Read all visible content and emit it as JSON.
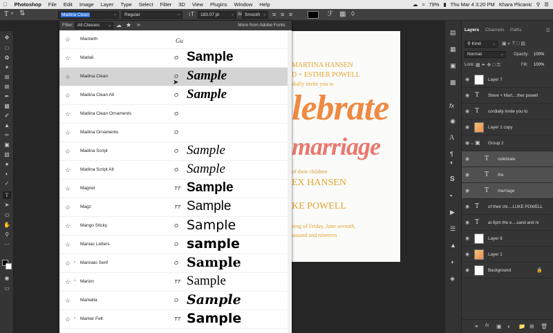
{
  "menubar": {
    "app": "Photoshop",
    "items": [
      "File",
      "Edit",
      "Image",
      "Layer",
      "Type",
      "Select",
      "Filter",
      "3D",
      "View",
      "Plugins",
      "Window",
      "Help"
    ],
    "battery": "79%",
    "datetime": "Thu Mar 4  3:20 PM",
    "user": "Khara Plicanic"
  },
  "options": {
    "font_family": "Madina Clean",
    "font_style": "Regular",
    "font_size": "183.07 pt",
    "aa_label": "aa",
    "antialias": "Smooth"
  },
  "font_panel": {
    "filter_label": "Filter:",
    "filter_value": "All Classes",
    "adobe_fonts": "More from Adobe Fonts:",
    "fonts": [
      {
        "name": "Macbeth",
        "type": "",
        "sample": "",
        "highlight": false,
        "expandable": false
      },
      {
        "name": "Madali",
        "type": "O",
        "sample": "Sample",
        "highlight": false,
        "expandable": false
      },
      {
        "name": "Madina Clean",
        "type": "O",
        "sample": "Sample",
        "highlight": true,
        "expandable": false
      },
      {
        "name": "Madina Clean Alt",
        "type": "O",
        "sample": "Sample",
        "highlight": false,
        "expandable": false
      },
      {
        "name": "Madina Clean Ornaments",
        "type": "O",
        "sample": "",
        "highlight": false,
        "expandable": false
      },
      {
        "name": "Madina Ornaments",
        "type": "O",
        "sample": "",
        "highlight": false,
        "expandable": false
      },
      {
        "name": "Madina Script",
        "type": "O",
        "sample": "Sample",
        "highlight": false,
        "expandable": false
      },
      {
        "name": "Madina Script Alt",
        "type": "O",
        "sample": "Sample",
        "highlight": false,
        "expandable": false
      },
      {
        "name": "Magnel",
        "type": "TT",
        "sample": "Sample",
        "highlight": false,
        "expandable": false
      },
      {
        "name": "Magz",
        "type": "TT",
        "sample": "Sample",
        "highlight": false,
        "expandable": false
      },
      {
        "name": "Mango Sticky",
        "type": "O",
        "sample": "Sample",
        "highlight": false,
        "expandable": false
      },
      {
        "name": "Maniac Letters",
        "type": "O",
        "sample": "sample",
        "highlight": false,
        "expandable": false
      },
      {
        "name": "Marinaio Serif",
        "type": "O",
        "sample": "Sample",
        "highlight": false,
        "expandable": true
      },
      {
        "name": "Marion",
        "type": "TT",
        "sample": "Sample",
        "highlight": false,
        "expandable": true
      },
      {
        "name": "Markella",
        "type": "O",
        "sample": "Sample",
        "highlight": false,
        "expandable": false
      },
      {
        "name": "Marker Felt",
        "type": "TT",
        "sample": "Sample",
        "highlight": false,
        "expandable": true
      }
    ]
  },
  "canvas": {
    "line1": "MARTINA HANSEN",
    "line2": "D + ESTHER POWELL",
    "line3": "dially invite you to",
    "line4": "lebrate",
    "line5": "marriage",
    "line6": "of their children",
    "line7": "EX HANSEN",
    "line8": "KE POWELL",
    "line9": "ning of Friday, June seventh,",
    "line10": "ousand and nineteen"
  },
  "layers_panel": {
    "tabs": [
      "Layers",
      "Channels",
      "Paths"
    ],
    "kind": "Kind",
    "blend_mode": "Normal",
    "opacity_label": "Opacity:",
    "opacity": "100%",
    "lock_label": "Lock:",
    "fill_label": "Fill:",
    "fill": "100%",
    "layers": [
      {
        "name": "Layer 7",
        "kind": "thumb",
        "indent": 0,
        "selected": false
      },
      {
        "name": "Steve + Mart....ther powell",
        "kind": "text",
        "indent": 0,
        "selected": false
      },
      {
        "name": "cordially invite you to",
        "kind": "text",
        "indent": 0,
        "selected": false
      },
      {
        "name": "Layer 1 copy",
        "kind": "thumb-color",
        "indent": 0,
        "selected": false
      },
      {
        "name": "Group 2",
        "kind": "group",
        "indent": 0,
        "selected": false
      },
      {
        "name": "celebrate",
        "kind": "text",
        "indent": 1,
        "selected": true
      },
      {
        "name": "the",
        "kind": "text",
        "indent": 1,
        "selected": true
      },
      {
        "name": "marriage",
        "kind": "text",
        "indent": 1,
        "selected": true
      },
      {
        "name": "of their chi....LUKE POWELL",
        "kind": "text",
        "indent": 0,
        "selected": false
      },
      {
        "name": "at 6pm the e....sand and ni",
        "kind": "text",
        "indent": 0,
        "selected": false
      },
      {
        "name": "Layer 8",
        "kind": "thumb",
        "indent": 0,
        "selected": false
      },
      {
        "name": "Layer 1",
        "kind": "thumb-color",
        "indent": 0,
        "selected": false
      },
      {
        "name": "Background",
        "kind": "thumb",
        "indent": 0,
        "selected": false
      }
    ]
  }
}
